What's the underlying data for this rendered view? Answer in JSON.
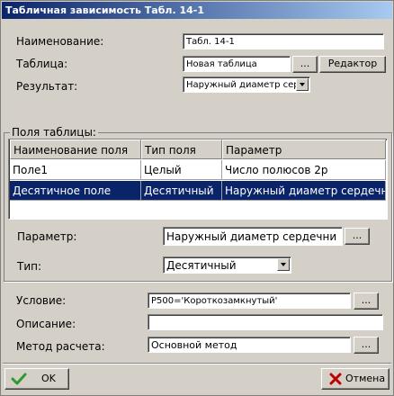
{
  "window": {
    "title": "Табличная зависимость Табл. 14-1"
  },
  "form": {
    "name_label": "Наименование:",
    "name_value": "Табл. 14-1",
    "table_label": "Таблица:",
    "table_value": "Новая таблица",
    "browse_label": "...",
    "editor_label": "Редактор",
    "result_label": "Результат:",
    "result_value": "Наружный диаметр серд."
  },
  "fields_group": {
    "title": "Поля таблицы:",
    "columns": [
      "Наименование поля",
      "Тип поля",
      "Параметр"
    ],
    "rows": [
      [
        "Поле1",
        "Целый",
        "Число полюсов 2р"
      ],
      [
        "Десятичное поле",
        "Десятичный",
        "Наружный диаметр сердечн"
      ]
    ],
    "selected_row": 1,
    "param_label": "Параметр:",
    "param_value": "Наружный диаметр сердечни",
    "param_browse": "...",
    "type_label": "Тип:",
    "type_value": "Десятичный"
  },
  "bottom": {
    "condition_label": "Условие:",
    "condition_value": "P500='Короткозамкнутый'",
    "condition_browse": "...",
    "description_label": "Описание:",
    "description_value": "",
    "method_label": "Метод расчета:",
    "method_value": "Основной метод",
    "method_browse": "..."
  },
  "buttons": {
    "ok": "OK",
    "cancel": "Отмена"
  },
  "colors": {
    "title_bar": "#0a246a",
    "selection": "#0a246a",
    "ok_check": "#2e9a2e",
    "cancel_x": "#c00000"
  }
}
